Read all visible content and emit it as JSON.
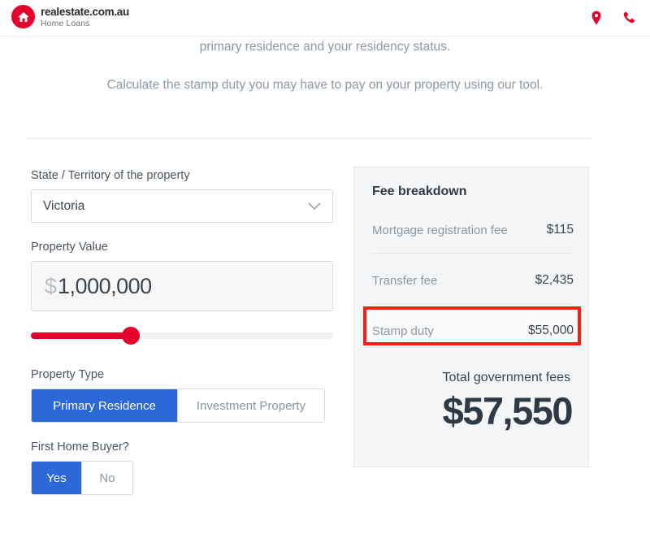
{
  "header": {
    "logo": {
      "icon": "house-in-circle-icon",
      "brand": "realestate.com.au",
      "sub": "Home Loans"
    },
    "icons": [
      {
        "name": "location-pin-icon",
        "color": "#e4002b"
      },
      {
        "name": "phone-icon",
        "color": "#e4002b"
      }
    ]
  },
  "intro": {
    "line1": "primary residence and your residency status.",
    "line2": "Calculate the stamp duty you may have to pay on your property using our tool."
  },
  "form": {
    "state_label": "State / Territory of the property",
    "state_value": "Victoria",
    "state_options": [
      "Victoria"
    ],
    "value_label": "Property Value",
    "currency_symbol": "$",
    "value_amount": "1,000,000",
    "slider": {
      "percent": 34
    },
    "property_type_label": "Property Type",
    "property_type_options": [
      {
        "label": "Primary Residence",
        "selected": true
      },
      {
        "label": "Investment Property",
        "selected": false
      }
    ],
    "first_home_buyer_label": "First Home Buyer?",
    "first_home_buyer_options": [
      {
        "label": "Yes",
        "selected": true
      },
      {
        "label": "No",
        "selected": false
      }
    ]
  },
  "fee_panel": {
    "title": "Fee breakdown",
    "rows": [
      {
        "label": "Mortgage registration fee",
        "value": "$115",
        "highlighted": false
      },
      {
        "label": "Transfer fee",
        "value": "$2,435",
        "highlighted": false
      },
      {
        "label": "Stamp duty",
        "value": "$55,000",
        "highlighted": true
      }
    ],
    "total_label": "Total government fees",
    "total_value": "$57,550"
  },
  "colors": {
    "brand_red": "#e4002b",
    "accent_blue": "#2d68d8",
    "highlight_red": "#fa1e0e",
    "panel_bg": "#f5f6f8"
  }
}
